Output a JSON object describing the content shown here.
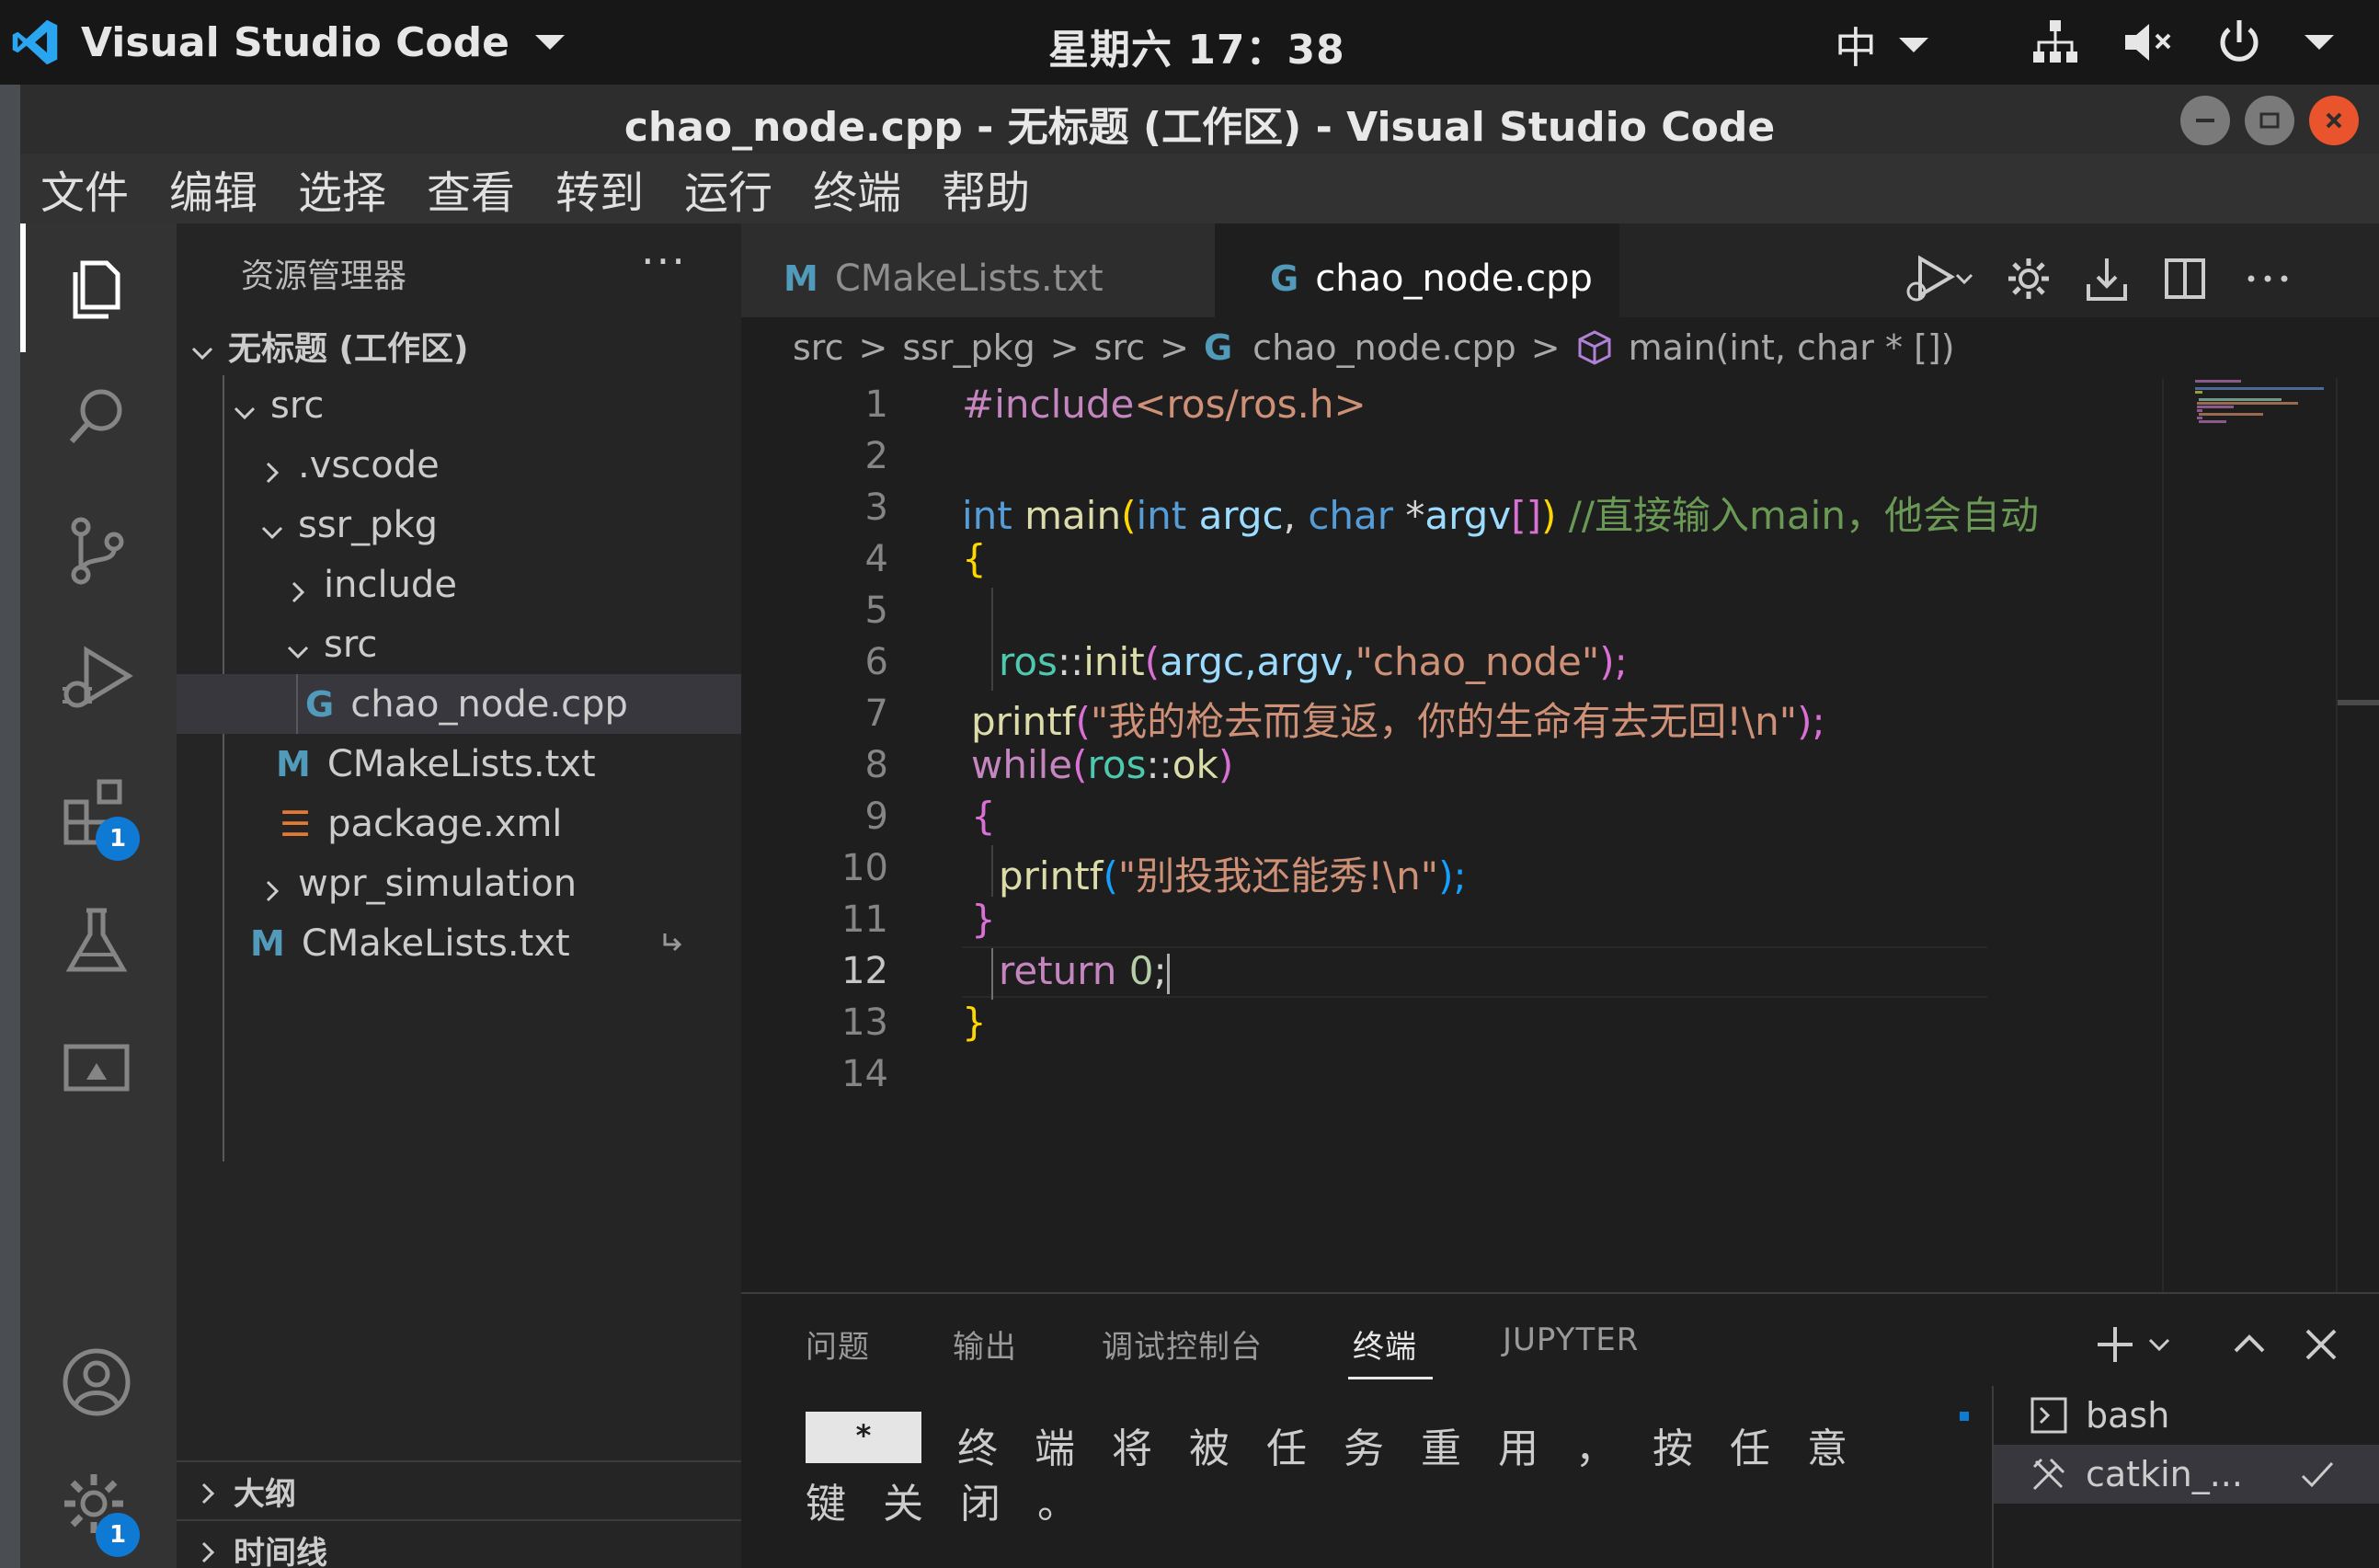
{
  "top_panel": {
    "app_name": "Visual Studio Code",
    "clock": "星期六 17：38",
    "input_method": "中"
  },
  "window": {
    "title": "chao_node.cpp - 无标题 (工作区) - Visual Studio Code"
  },
  "menu": [
    "文件",
    "编辑",
    "选择",
    "查看",
    "转到",
    "运行",
    "终端",
    "帮助"
  ],
  "activity_bar": {
    "icons": [
      "files-icon",
      "search-icon",
      "source-control-icon",
      "run-debug-icon",
      "extensions-icon",
      "testing-icon",
      "remote-explorer-icon",
      "account-icon",
      "gear-icon"
    ],
    "extensions_badge": "1",
    "settings_badge": "1"
  },
  "sidebar": {
    "title": "资源管理器",
    "more": "···",
    "workspace": "无标题 (工作区)",
    "tree": [
      {
        "label": "src"
      },
      {
        "label": ".vscode"
      },
      {
        "label": "ssr_pkg"
      },
      {
        "label": "include"
      },
      {
        "label": "src"
      },
      {
        "label": "chao_node.cpp"
      },
      {
        "label": "CMakeLists.txt"
      },
      {
        "label": "package.xml"
      },
      {
        "label": "wpr_simulation"
      },
      {
        "label": "CMakeLists.txt"
      }
    ],
    "sections": [
      "大纲",
      "时间线"
    ]
  },
  "tabs": [
    {
      "label": "CMakeLists.txt",
      "icon": "M"
    },
    {
      "label": "chao_node.cpp",
      "icon": "G"
    }
  ],
  "breadcrumbs": [
    "src",
    "ssr_pkg",
    "src",
    "chao_node.cpp",
    "main(int, char * [])"
  ],
  "editor": {
    "line_numbers": [
      "1",
      "2",
      "3",
      "4",
      "5",
      "6",
      "7",
      "8",
      "9",
      "10",
      "11",
      "12",
      "13",
      "14"
    ],
    "current_line": "12",
    "code": {
      "l1_dir": "#include",
      "l1_hdr": "<ros/ros.h>",
      "l3_int": "int",
      "l3_main": "main",
      "l3_p1": "(",
      "l3_int2": "int",
      "l3_argc": "argc",
      "l3_comma": ", ",
      "l3_char": "char",
      "l3_star": " *",
      "l3_argv": "argv",
      "l3_br": "[]",
      "l3_p2": ")",
      "l3_comment": "//直接输入main，他会自动",
      "l4_brace": "{",
      "l6_ns": "ros",
      "l6_sep": "::",
      "l6_fn": "init",
      "l6_p1": "(",
      "l6_args": "argc,argv,",
      "l6_str": "\"chao_node\"",
      "l6_p2": ");",
      "l7_fn": "printf",
      "l7_p1": "(",
      "l7_str": "\"我的枪去而复返，你的生命有去无回!\\n\"",
      "l7_p2": ");",
      "l8_kw": "while",
      "l8_p1": "(",
      "l8_ns": "ros",
      "l8_sep": "::",
      "l8_fn": "ok",
      "l8_p2": ")",
      "l9_brace": "{",
      "l10_fn": "printf",
      "l10_p1": "(",
      "l10_str": "\"别投我还能秀!\\n\"",
      "l10_p2": ");",
      "l11_brace": "}",
      "l12_kw": "return",
      "l12_num": " 0",
      "l12_semi": ";",
      "l13_brace": "}"
    }
  },
  "panel": {
    "tabs": [
      "问题",
      "输出",
      "调试控制台",
      "终端",
      "JUPYTER"
    ],
    "active_tab": "终端",
    "terminal_marker": "*",
    "terminal_line1": "终端将被任务重用，按任意",
    "terminal_line2": "键关闭。",
    "terminals": [
      "bash",
      "catkin_..."
    ]
  }
}
